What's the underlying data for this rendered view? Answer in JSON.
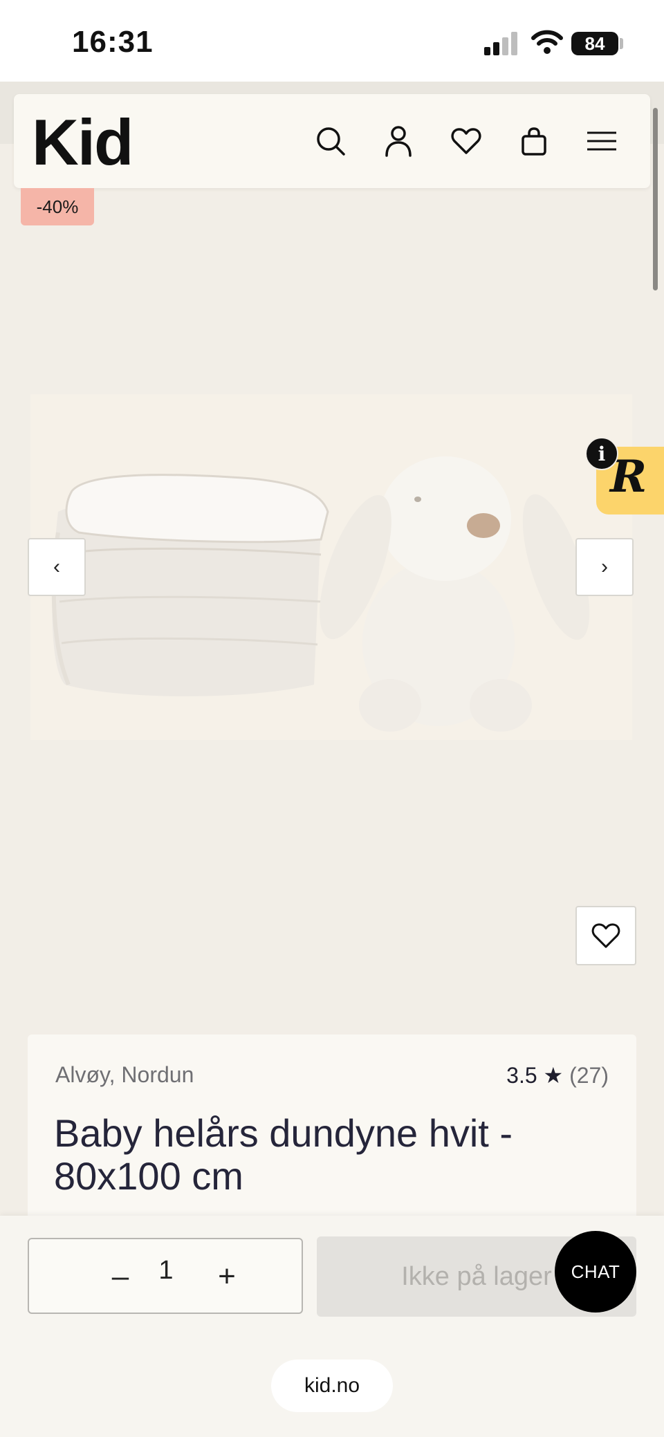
{
  "status_bar": {
    "time": "16:31",
    "battery": "84"
  },
  "header": {
    "logo": "Kid",
    "icons": [
      "search-icon",
      "account-icon",
      "wishlist-icon",
      "cart-icon",
      "menu-icon"
    ]
  },
  "product": {
    "discount": "-40%",
    "brand": "Alvøy, Nordun",
    "rating": "3.5 ★",
    "review_count": "(27)",
    "title": "Baby helårs dundyne hvit - 80x100 cm"
  },
  "gallery": {
    "prev": "‹",
    "next": "›"
  },
  "widget": {
    "letter": "R",
    "info": "i"
  },
  "purchase": {
    "quantity": "1",
    "minus": "–",
    "plus": "+",
    "stock_label": "Ikke på lager"
  },
  "chat": {
    "label": "CHAT"
  },
  "browser": {
    "url": "kid.no"
  },
  "colors": {
    "page_bg": "#f2eee7",
    "badge": "#f5b5a8",
    "widget": "#fcd46b",
    "chat": "#000000"
  }
}
